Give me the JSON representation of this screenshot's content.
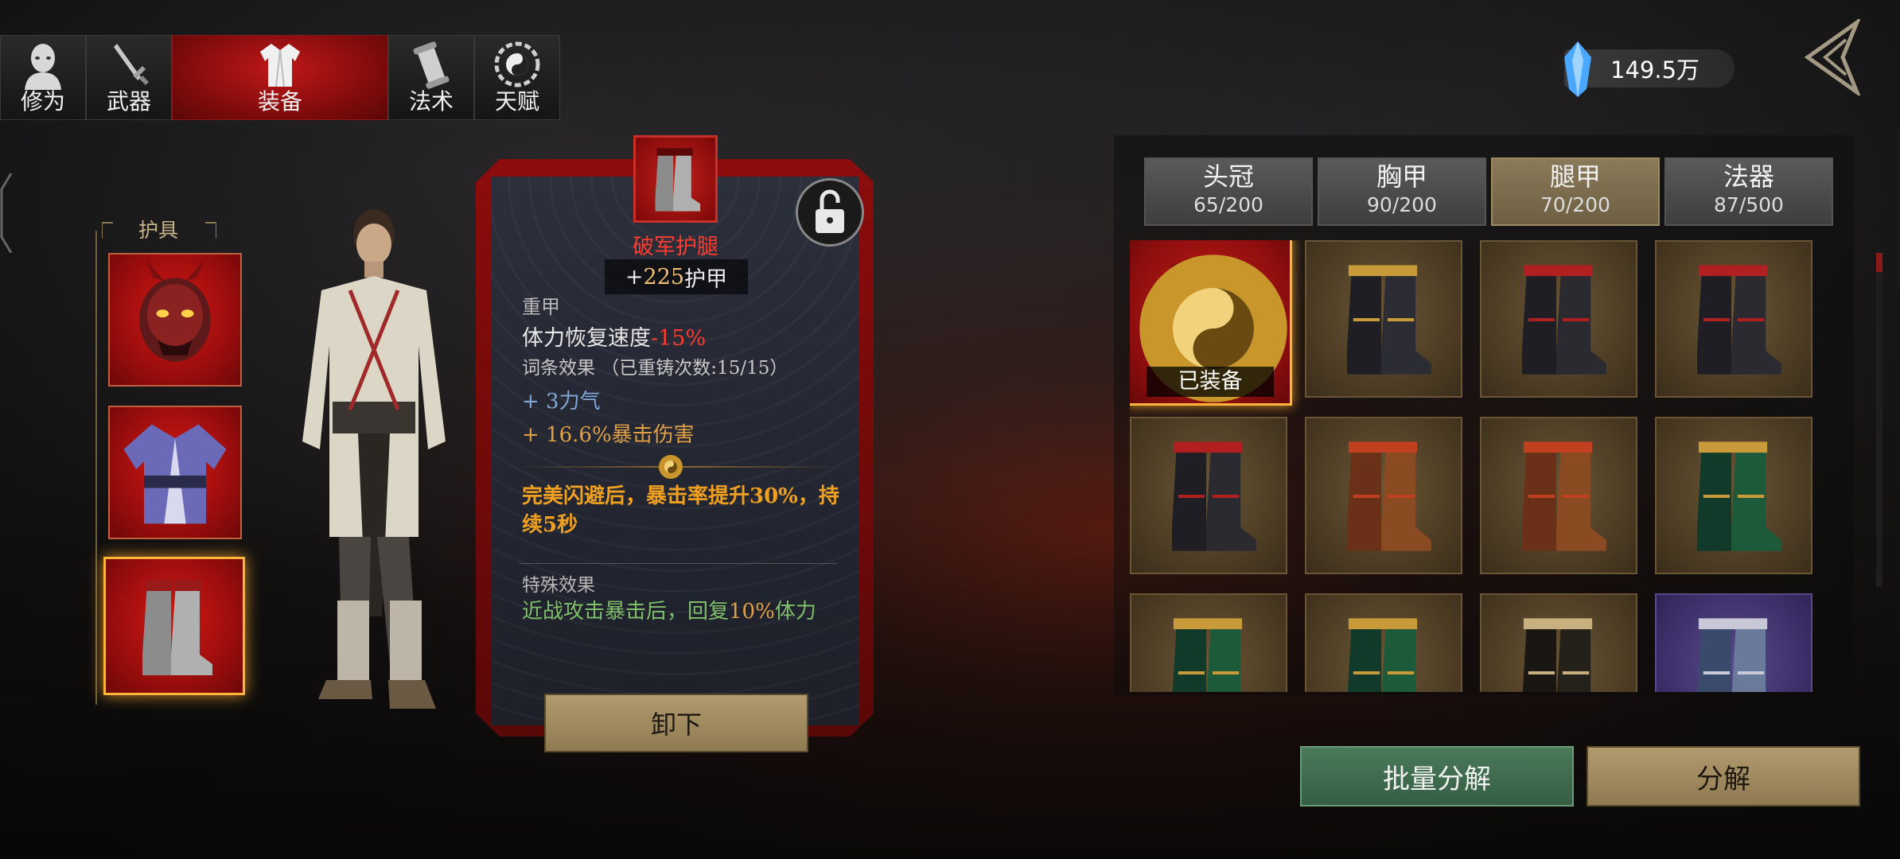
{
  "tabs": [
    {
      "label": "修为",
      "icon": "person-head-icon"
    },
    {
      "label": "武器",
      "icon": "sword-icon"
    },
    {
      "label": "装备",
      "icon": "robe-icon"
    },
    {
      "label": "法术",
      "icon": "scroll-icon"
    },
    {
      "label": "天赋",
      "icon": "bagua-icon"
    }
  ],
  "active_tab": "装备",
  "currency": {
    "value": "149.5万",
    "icon": "crystal-icon"
  },
  "armor_section": {
    "title": "护具",
    "slots": [
      "demon-mask-icon",
      "robe-icon",
      "boots-icon"
    ]
  },
  "detail": {
    "name": "破军护腿",
    "armor_prefix": "+",
    "armor_value": "225",
    "armor_label": "护甲",
    "type": "重甲",
    "stat_label": "体力恢复速度",
    "stat_value": "-15%",
    "affix_title": "词条效果 （已重铸次数:15/15）",
    "bonus1": "+ 3力气",
    "bonus2": "+ 16.6%暴击伤害",
    "set_effect": "完美闪避后，暴击率提升30%，持续5秒",
    "special_title": "特殊效果",
    "special_pre": "近战攻击暴击后，回复",
    "special_hl": "10%",
    "special_post": "体力",
    "unequip_label": "卸下"
  },
  "categories": [
    {
      "name": "头冠",
      "count": "65/200"
    },
    {
      "name": "胸甲",
      "count": "90/200"
    },
    {
      "name": "腿甲",
      "count": "70/200"
    },
    {
      "name": "法器",
      "count": "87/500"
    }
  ],
  "active_category": "腿甲",
  "equipped_label": "已装备",
  "inventory": [
    {
      "style": "red",
      "boot": "silver-dragon-boots"
    },
    {
      "style": "gold",
      "boot": "black-gold-boots"
    },
    {
      "style": "gold",
      "boot": "black-red-boots"
    },
    {
      "style": "gold",
      "boot": "black-red-boots"
    },
    {
      "style": "gold",
      "boot": "black-red-boots"
    },
    {
      "style": "gold",
      "boot": "brown-red-boots"
    },
    {
      "style": "gold",
      "boot": "brown-red-boots"
    },
    {
      "style": "gold",
      "boot": "green-gold-boots"
    },
    {
      "style": "gold",
      "boot": "green-gold-boots"
    },
    {
      "style": "gold",
      "boot": "green-gold-boots"
    },
    {
      "style": "gold",
      "boot": "black-pattern-boots"
    },
    {
      "style": "purple",
      "boot": "blue-silver-boots"
    }
  ],
  "buttons": {
    "batch": "批量分解",
    "decompose": "分解"
  },
  "colors": {
    "accent_red": "#c01818",
    "gold_frame": "#ffb43c",
    "negative": "#ff3a2e",
    "bonus_blue": "#7fa8d8",
    "bonus_gold": "#e0a045",
    "set_orange": "#f0a020",
    "special_green": "#7fbf6a"
  }
}
